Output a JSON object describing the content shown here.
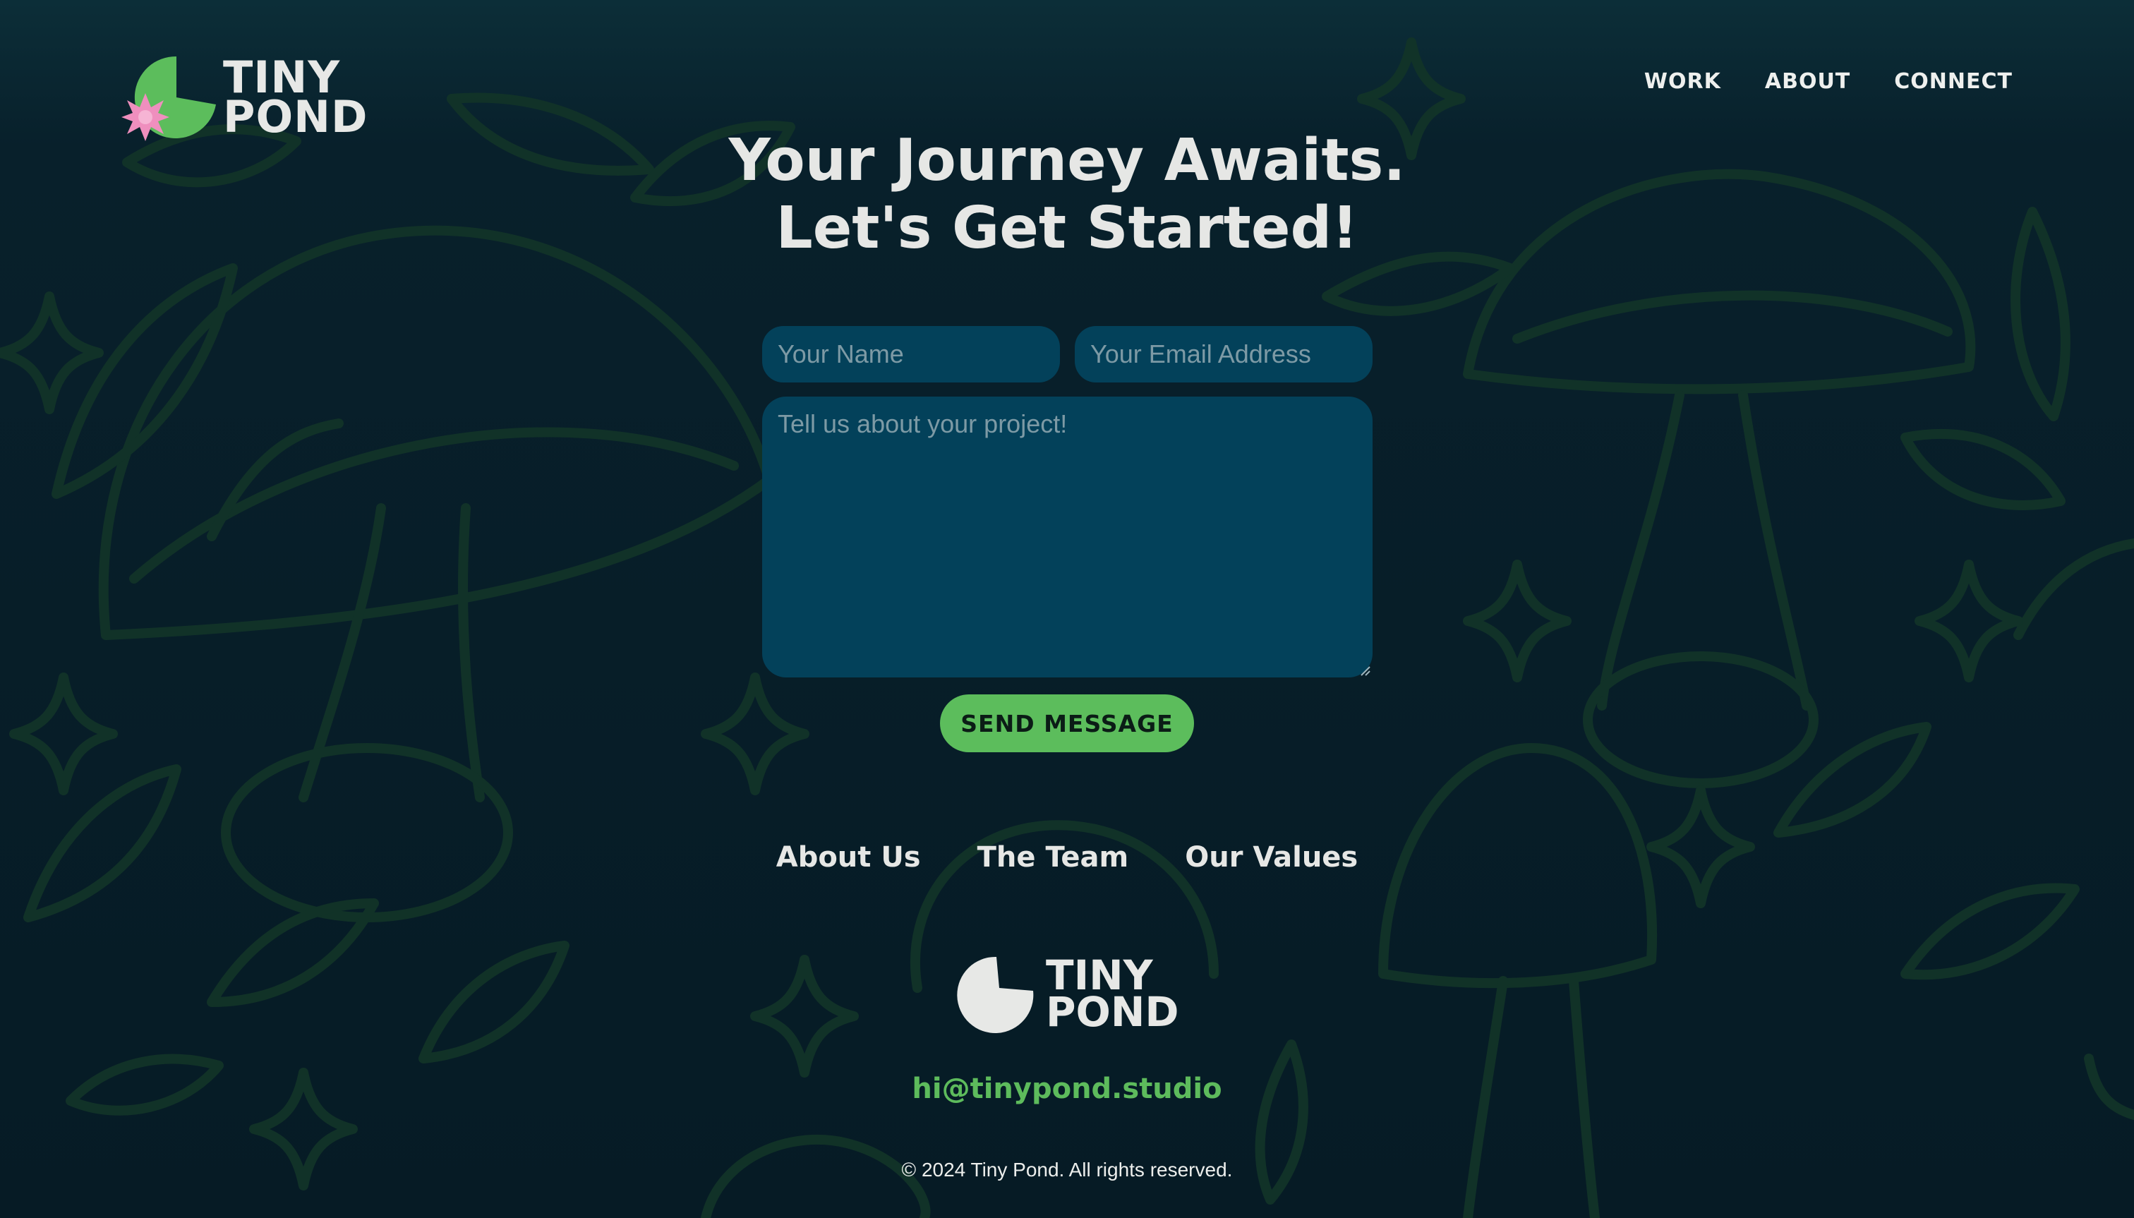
{
  "header": {
    "logo_line1": "TINY",
    "logo_line2": "POND",
    "nav": [
      {
        "label": "WORK"
      },
      {
        "label": "ABOUT"
      },
      {
        "label": "CONNECT"
      }
    ]
  },
  "hero": {
    "line1": "Your Journey Awaits.",
    "line2": "Let's Get Started!"
  },
  "form": {
    "name_placeholder": "Your Name",
    "email_placeholder": "Your Email Address",
    "message_placeholder": "Tell us about your project!",
    "send_label": "SEND MESSAGE"
  },
  "footer": {
    "links": [
      {
        "label": "About Us"
      },
      {
        "label": "The Team"
      },
      {
        "label": "Our Values"
      }
    ],
    "logo_line1": "TINY",
    "logo_line2": "POND",
    "email": "hi@tinypond.studio",
    "copyright": "© 2024 Tiny Pond. All rights reserved."
  },
  "colors": {
    "background": "#061b25",
    "field": "#03415a",
    "accent_green": "#5cbd5c",
    "lotus_pink": "#ef8fbe",
    "text": "#e6e7e5"
  },
  "icons": {
    "logo_mark": "lily-pad-with-lotus-icon",
    "footer_mark": "lily-pad-icon",
    "background_pattern": "mushroom-leaf-sparkle-pattern"
  }
}
